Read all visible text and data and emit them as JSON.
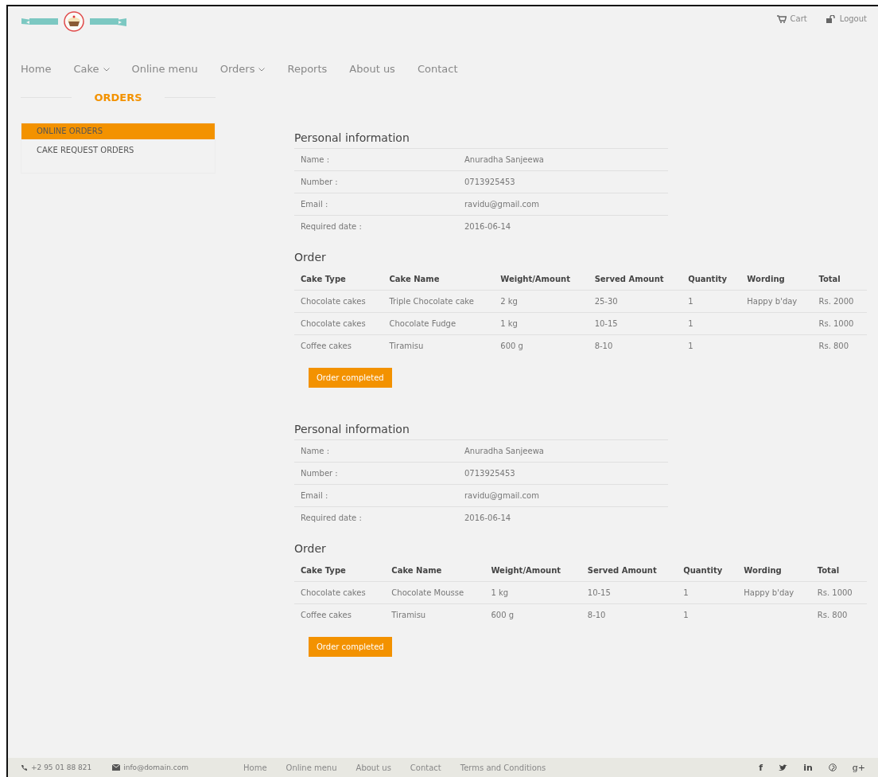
{
  "header": {
    "links": [
      {
        "kind": "cart",
        "label": "Cart"
      },
      {
        "kind": "logout",
        "label": "Logout"
      }
    ]
  },
  "nav": [
    {
      "label": "Home",
      "dropdown": false
    },
    {
      "label": "Cake",
      "dropdown": true
    },
    {
      "label": "Online menu",
      "dropdown": false
    },
    {
      "label": "Orders",
      "dropdown": true
    },
    {
      "label": "Reports",
      "dropdown": false
    },
    {
      "label": "About us",
      "dropdown": false
    },
    {
      "label": "Contact",
      "dropdown": false
    }
  ],
  "sidebar": {
    "title": "ORDERS",
    "items": [
      {
        "label": "ONLINE ORDERS",
        "selected": true
      },
      {
        "label": "CAKE REQUEST ORDERS",
        "selected": false
      }
    ]
  },
  "orders": [
    {
      "personal_title": "Personal information",
      "personal": [
        {
          "label": "Name :",
          "value": "Anuradha Sanjeewa"
        },
        {
          "label": "Number :",
          "value": "0713925453"
        },
        {
          "label": "Email :",
          "value": "ravidu@gmail.com"
        },
        {
          "label": "Required date :",
          "value": "2016-06-14"
        }
      ],
      "order_title": "Order",
      "columns": [
        "Cake Type",
        "Cake Name",
        "Weight/Amount",
        "Served Amount",
        "Quantity",
        "Wording",
        "Total"
      ],
      "rows": [
        [
          "Chocolate cakes",
          "Triple Chocolate cake",
          "2 kg",
          "25-30",
          "1",
          "Happy b'day",
          "Rs. 2000"
        ],
        [
          "Chocolate cakes",
          "Chocolate Fudge",
          "1 kg",
          "10-15",
          "1",
          "",
          "Rs. 1000"
        ],
        [
          "Coffee cakes",
          "Tiramisu",
          "600 g",
          "8-10",
          "1",
          "",
          "Rs. 800"
        ]
      ],
      "button": "Order completed"
    },
    {
      "personal_title": "Personal information",
      "personal": [
        {
          "label": "Name :",
          "value": "Anuradha Sanjeewa"
        },
        {
          "label": "Number :",
          "value": "0713925453"
        },
        {
          "label": "Email :",
          "value": "ravidu@gmail.com"
        },
        {
          "label": "Required date :",
          "value": "2016-06-14"
        }
      ],
      "order_title": "Order",
      "columns": [
        "Cake Type",
        "Cake Name",
        "Weight/Amount",
        "Served Amount",
        "Quantity",
        "Wording",
        "Total"
      ],
      "rows": [
        [
          "Chocolate cakes",
          "Chocolate Mousse",
          "1 kg",
          "10-15",
          "1",
          "Happy b'day",
          "Rs. 1000"
        ],
        [
          "Coffee cakes",
          "Tiramisu",
          "600 g",
          "8-10",
          "1",
          "",
          "Rs. 800"
        ]
      ],
      "button": "Order completed"
    }
  ],
  "footer": {
    "contacts": [
      {
        "kind": "phone",
        "text": "+2 95 01 88 821"
      },
      {
        "kind": "email",
        "text": "info@domain.com"
      }
    ],
    "links": [
      "Home",
      "Online menu",
      "About us",
      "Contact",
      "Terms and Conditions"
    ],
    "social": [
      {
        "kind": "facebook",
        "glyph": "f"
      },
      {
        "kind": "twitter"
      },
      {
        "kind": "linkedin",
        "glyph": "in"
      },
      {
        "kind": "pinterest"
      },
      {
        "kind": "googleplus",
        "glyph": "g+"
      }
    ]
  }
}
